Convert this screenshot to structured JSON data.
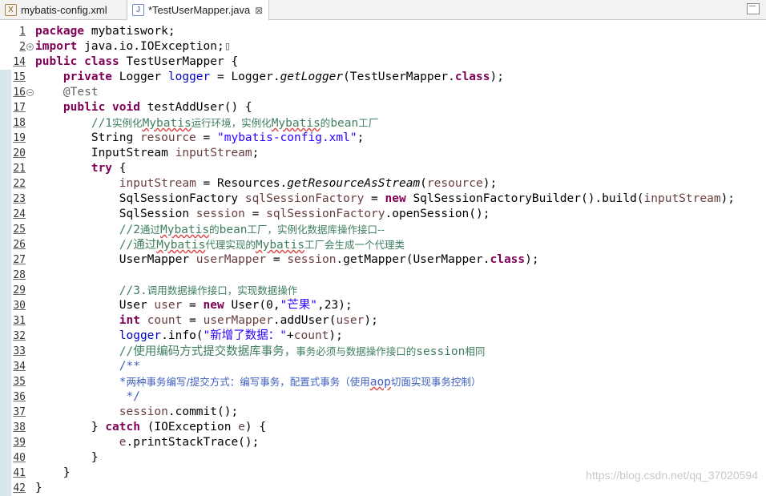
{
  "tabs": [
    {
      "label": "mybatis-config.xml",
      "icon": "xml-file-icon"
    },
    {
      "label": "*TestUserMapper.java",
      "icon": "java-file-icon",
      "close": "⊠"
    }
  ],
  "watermark": "https://blog.csdn.net/qq_37020594",
  "lines": [
    {
      "n": "1",
      "fold": "",
      "segs": [
        {
          "t": "package",
          "c": "kw"
        },
        {
          "t": " mybatiswork;"
        }
      ]
    },
    {
      "n": "2",
      "fold": "⊕",
      "segs": [
        {
          "t": "import",
          "c": "kw"
        },
        {
          "t": " java.io.IOException;"
        },
        {
          "t": "▯",
          "c": "ann"
        }
      ]
    },
    {
      "n": "14",
      "fold": "",
      "segs": [
        {
          "t": "public",
          "c": "kw"
        },
        {
          "t": " "
        },
        {
          "t": "class",
          "c": "kw"
        },
        {
          "t": " TestUserMapper {"
        }
      ]
    },
    {
      "n": "15",
      "fold": "",
      "segs": [
        {
          "t": "    "
        },
        {
          "t": "private",
          "c": "kw"
        },
        {
          "t": " Logger "
        },
        {
          "t": "logger",
          "c": "fld"
        },
        {
          "t": " = Logger."
        },
        {
          "t": "getLogger",
          "c": "ital"
        },
        {
          "t": "(TestUserMapper."
        },
        {
          "t": "class",
          "c": "kw"
        },
        {
          "t": ");"
        }
      ]
    },
    {
      "n": "16",
      "fold": "⊖",
      "segs": [
        {
          "t": "    "
        },
        {
          "t": "@Test",
          "c": "ann"
        }
      ]
    },
    {
      "n": "17",
      "fold": "",
      "segs": [
        {
          "t": "    "
        },
        {
          "t": "public",
          "c": "kw"
        },
        {
          "t": " "
        },
        {
          "t": "void",
          "c": "kw"
        },
        {
          "t": " testAddUser() {"
        }
      ]
    },
    {
      "n": "18",
      "fold": "",
      "segs": [
        {
          "t": "        "
        },
        {
          "t": "//1",
          "c": "cmt"
        },
        {
          "t": "实例化",
          "c": "cmt cjk"
        },
        {
          "t": "Mybatis",
          "c": "cmt wavy"
        },
        {
          "t": "运行环境，实例化",
          "c": "cmt cjk"
        },
        {
          "t": "Mybatis",
          "c": "cmt wavy"
        },
        {
          "t": "的",
          "c": "cmt cjk"
        },
        {
          "t": "bean",
          "c": "cmt"
        },
        {
          "t": "工厂",
          "c": "cmt cjk"
        }
      ]
    },
    {
      "n": "19",
      "fold": "",
      "segs": [
        {
          "t": "        String "
        },
        {
          "t": "resource",
          "c": "var"
        },
        {
          "t": " = "
        },
        {
          "t": "\"mybatis-config.xml\"",
          "c": "str"
        },
        {
          "t": ";"
        }
      ]
    },
    {
      "n": "20",
      "fold": "",
      "segs": [
        {
          "t": "        InputStream "
        },
        {
          "t": "inputStream",
          "c": "var"
        },
        {
          "t": ";"
        }
      ]
    },
    {
      "n": "21",
      "fold": "",
      "segs": [
        {
          "t": "        "
        },
        {
          "t": "try",
          "c": "kw"
        },
        {
          "t": " {"
        }
      ]
    },
    {
      "n": "22",
      "fold": "",
      "segs": [
        {
          "t": "            "
        },
        {
          "t": "inputStream",
          "c": "var"
        },
        {
          "t": " = Resources."
        },
        {
          "t": "getResourceAsStream",
          "c": "ital"
        },
        {
          "t": "("
        },
        {
          "t": "resource",
          "c": "var"
        },
        {
          "t": ");"
        }
      ]
    },
    {
      "n": "23",
      "fold": "",
      "segs": [
        {
          "t": "            SqlSessionFactory "
        },
        {
          "t": "sqlSessionFactory",
          "c": "var"
        },
        {
          "t": " = "
        },
        {
          "t": "new",
          "c": "kw"
        },
        {
          "t": " SqlSessionFactoryBuilder().build("
        },
        {
          "t": "inputStream",
          "c": "var"
        },
        {
          "t": ");"
        }
      ]
    },
    {
      "n": "24",
      "fold": "",
      "segs": [
        {
          "t": "            SqlSession "
        },
        {
          "t": "session",
          "c": "var"
        },
        {
          "t": " = "
        },
        {
          "t": "sqlSessionFactory",
          "c": "var"
        },
        {
          "t": ".openSession();"
        }
      ]
    },
    {
      "n": "25",
      "fold": "",
      "segs": [
        {
          "t": "            "
        },
        {
          "t": "//2",
          "c": "cmt"
        },
        {
          "t": "通过",
          "c": "cmt cjk"
        },
        {
          "t": "Mybatis",
          "c": "cmt wavy"
        },
        {
          "t": "的",
          "c": "cmt cjk"
        },
        {
          "t": "bean",
          "c": "cmt"
        },
        {
          "t": "工厂，实例化数据库操作接口--",
          "c": "cmt cjk"
        }
      ]
    },
    {
      "n": "26",
      "fold": "",
      "segs": [
        {
          "t": "            "
        },
        {
          "t": "//",
          "c": "cmt"
        },
        {
          "t": "通过",
          "c": "cmt"
        },
        {
          "t": "Mybatis",
          "c": "cmt wavy"
        },
        {
          "t": "代理实现的",
          "c": "cmt cjk"
        },
        {
          "t": "Mybatis",
          "c": "cmt wavy"
        },
        {
          "t": "工厂会生成一个代理类",
          "c": "cmt cjk"
        }
      ]
    },
    {
      "n": "27",
      "fold": "",
      "segs": [
        {
          "t": "            UserMapper "
        },
        {
          "t": "userMapper",
          "c": "var"
        },
        {
          "t": " = "
        },
        {
          "t": "session",
          "c": "var"
        },
        {
          "t": ".getMapper(UserMapper."
        },
        {
          "t": "class",
          "c": "kw"
        },
        {
          "t": ");"
        }
      ]
    },
    {
      "n": "28",
      "fold": "",
      "segs": [
        {
          "t": ""
        }
      ]
    },
    {
      "n": "29",
      "fold": "",
      "segs": [
        {
          "t": "            "
        },
        {
          "t": "//3.",
          "c": "cmt"
        },
        {
          "t": "调用数据操作接口，实现数据操作",
          "c": "cmt cjk"
        }
      ]
    },
    {
      "n": "30",
      "fold": "",
      "segs": [
        {
          "t": "            User "
        },
        {
          "t": "user",
          "c": "var"
        },
        {
          "t": " = "
        },
        {
          "t": "new",
          "c": "kw"
        },
        {
          "t": " User(0,"
        },
        {
          "t": "\"芒果\"",
          "c": "str"
        },
        {
          "t": ",23);"
        }
      ]
    },
    {
      "n": "31",
      "fold": "",
      "segs": [
        {
          "t": "            "
        },
        {
          "t": "int",
          "c": "kw"
        },
        {
          "t": " "
        },
        {
          "t": "count",
          "c": "var"
        },
        {
          "t": " = "
        },
        {
          "t": "userMapper",
          "c": "var"
        },
        {
          "t": ".addUser("
        },
        {
          "t": "user",
          "c": "var"
        },
        {
          "t": ");"
        }
      ]
    },
    {
      "n": "32",
      "fold": "",
      "segs": [
        {
          "t": "            "
        },
        {
          "t": "logger",
          "c": "fld"
        },
        {
          "t": ".info("
        },
        {
          "t": "\"新增了数据：\"",
          "c": "str"
        },
        {
          "t": "+"
        },
        {
          "t": "count",
          "c": "var"
        },
        {
          "t": ");"
        }
      ]
    },
    {
      "n": "33",
      "fold": "",
      "segs": [
        {
          "t": "            "
        },
        {
          "t": "//使用编码方式提交数据库事务，",
          "c": "cmt"
        },
        {
          "t": "事务必须与数据操作接口的",
          "c": "cmt cjk"
        },
        {
          "t": "session",
          "c": "cmt"
        },
        {
          "t": "相同",
          "c": "cmt cjk"
        }
      ]
    },
    {
      "n": "34",
      "fold": "",
      "segs": [
        {
          "t": "            "
        },
        {
          "t": "/**",
          "c": "jdoc"
        }
      ]
    },
    {
      "n": "35",
      "fold": "",
      "segs": [
        {
          "t": "            "
        },
        {
          "t": "*",
          "c": "jdoc"
        },
        {
          "t": "两种事务编写/提交方式：编写事务，配置式事务（使用",
          "c": "jdoc cjk"
        },
        {
          "t": "aop",
          "c": "jdoc wavy"
        },
        {
          "t": "切面实现事务控制）",
          "c": "jdoc cjk"
        }
      ]
    },
    {
      "n": "36",
      "fold": "",
      "segs": [
        {
          "t": "             "
        },
        {
          "t": "*/",
          "c": "jdoc"
        }
      ]
    },
    {
      "n": "37",
      "fold": "",
      "segs": [
        {
          "t": "            "
        },
        {
          "t": "session",
          "c": "var"
        },
        {
          "t": ".commit();"
        }
      ]
    },
    {
      "n": "38",
      "fold": "",
      "segs": [
        {
          "t": "        } "
        },
        {
          "t": "catch",
          "c": "kw"
        },
        {
          "t": " (IOException "
        },
        {
          "t": "e",
          "c": "var"
        },
        {
          "t": ") {"
        }
      ]
    },
    {
      "n": "39",
      "fold": "",
      "segs": [
        {
          "t": "            "
        },
        {
          "t": "e",
          "c": "var"
        },
        {
          "t": ".printStackTrace();"
        }
      ]
    },
    {
      "n": "40",
      "fold": "",
      "segs": [
        {
          "t": "        }"
        }
      ]
    },
    {
      "n": "41",
      "fold": "",
      "segs": [
        {
          "t": "    }"
        }
      ]
    },
    {
      "n": "42",
      "fold": "",
      "segs": [
        {
          "t": "}"
        }
      ]
    }
  ]
}
